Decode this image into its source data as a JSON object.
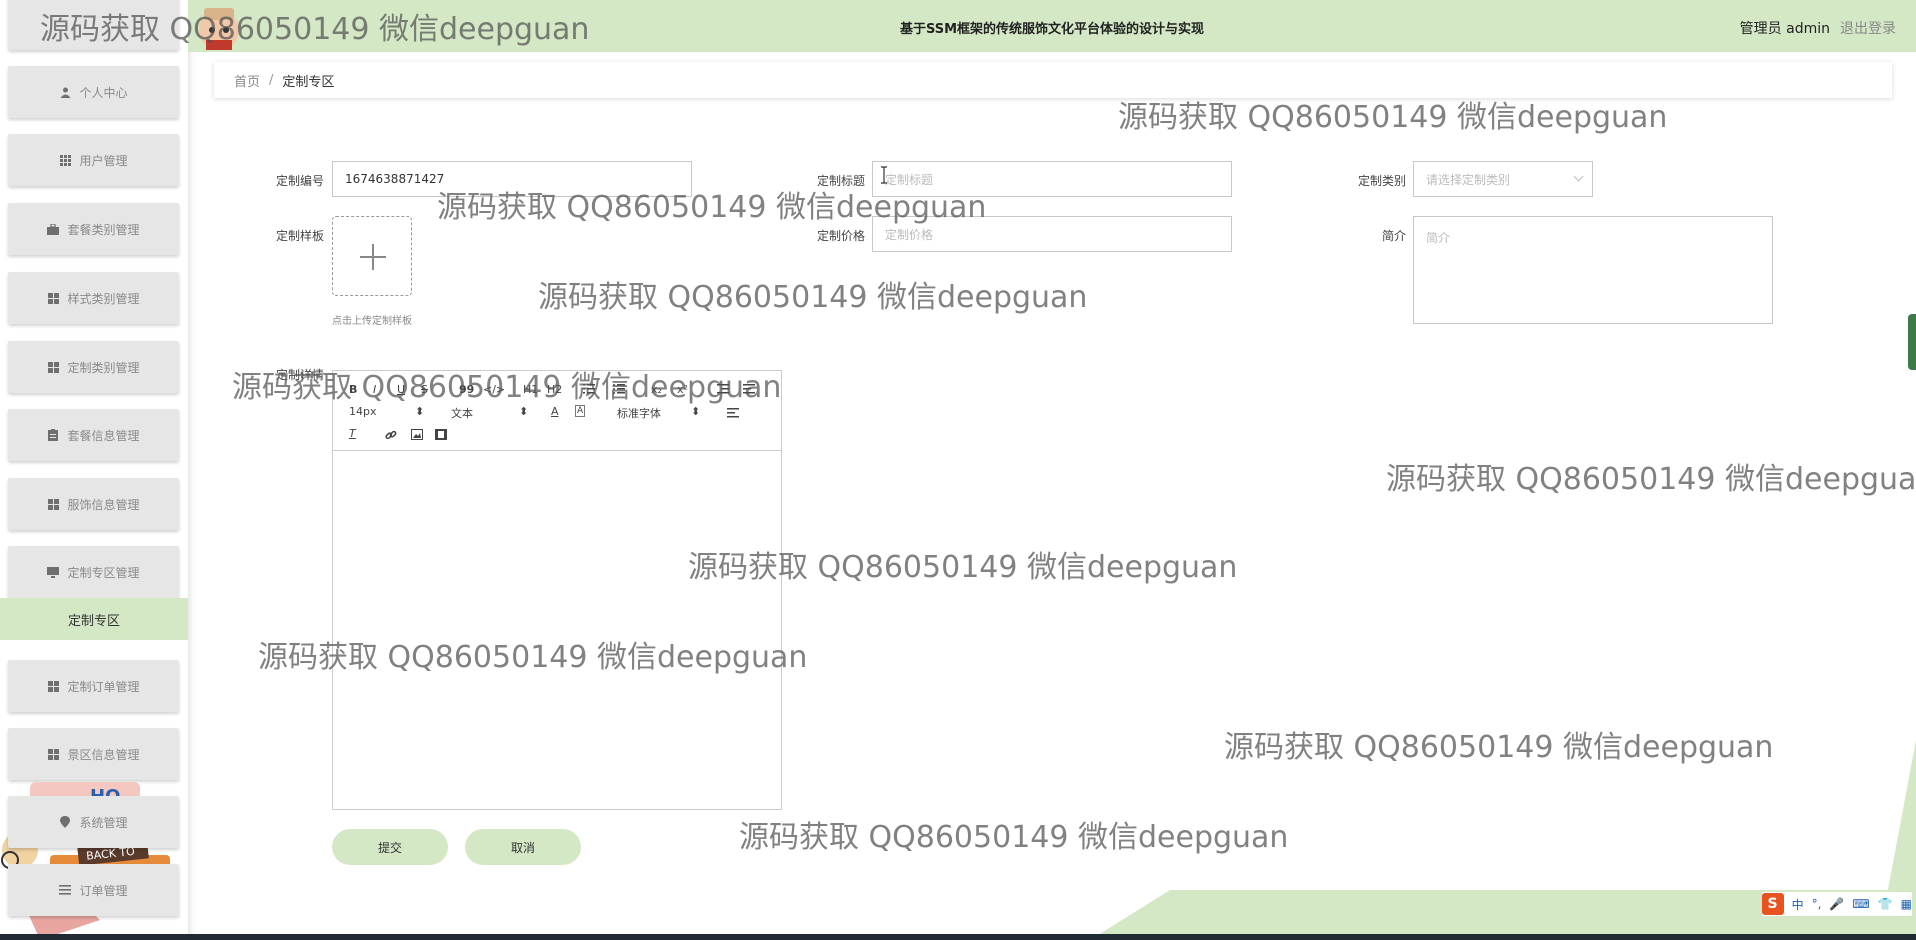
{
  "header": {
    "title": "基于SSM框架的传统服饰文化平台体验的设计与实现",
    "user": "管理员 admin",
    "logout": "退出登录"
  },
  "sidebar": {
    "items": [
      {
        "label": "个人中心",
        "icon": "person-icon"
      },
      {
        "label": "用户管理",
        "icon": "grid-icon"
      },
      {
        "label": "套餐类别管理",
        "icon": "briefcase-icon"
      },
      {
        "label": "样式类别管理",
        "icon": "grid-icon"
      },
      {
        "label": "定制类别管理",
        "icon": "grid-icon"
      },
      {
        "label": "套餐信息管理",
        "icon": "clipboard-icon"
      },
      {
        "label": "服饰信息管理",
        "icon": "grid-icon"
      },
      {
        "label": "定制专区管理",
        "icon": "monitor-icon"
      },
      {
        "label": "定制订单管理",
        "icon": "grid-icon"
      },
      {
        "label": "景区信息管理",
        "icon": "grid-icon"
      },
      {
        "label": "系统管理",
        "icon": "location-icon"
      },
      {
        "label": "订单管理",
        "icon": "list-icon"
      }
    ],
    "active_sub": "定制专区",
    "sticker_text": "BACK TO"
  },
  "breadcrumb": {
    "home": "首页",
    "separator": "/",
    "current": "定制专区"
  },
  "form": {
    "number_label": "定制编号",
    "number_value": "1674638871427",
    "title_label": "定制标题",
    "title_placeholder": "定制标题",
    "category_label": "定制类别",
    "category_placeholder": "请选择定制类别",
    "sample_label": "定制样板",
    "upload_tip": "点击上传定制样板",
    "price_label": "定制价格",
    "price_placeholder": "定制价格",
    "intro_label": "简介",
    "intro_placeholder": "简介",
    "detail_label": "定制详情"
  },
  "editor": {
    "font_size": "14px",
    "paragraph": "文本",
    "font_family": "标准字体",
    "buttons": [
      "B",
      "I",
      "U",
      "S",
      "99",
      "</>",
      "H1",
      "H2",
      "ordered-list",
      "bullet-list",
      "x2-sub",
      "x2-sup",
      "indent",
      "outdent",
      "font-color",
      "background-color",
      "align",
      "clear-format",
      "link",
      "image",
      "video"
    ]
  },
  "actions": {
    "submit": "提交",
    "cancel": "取消"
  },
  "watermark": "源码获取 QQ86050149 微信deepguan",
  "ime": {
    "logo": "S",
    "lang": "中"
  },
  "colors": {
    "accent_green": "#d4e8c6",
    "sidebar_button": "#e6e6e6"
  }
}
